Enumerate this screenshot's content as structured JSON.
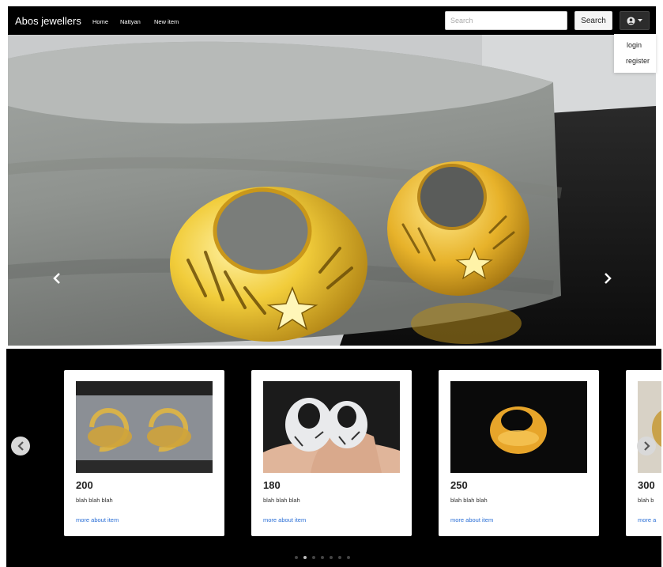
{
  "navbar": {
    "brand": "Abos jewellers",
    "links": [
      "Home",
      "Nattyan",
      "New item"
    ],
    "search_placeholder": "Search",
    "search_button": "Search"
  },
  "user_menu": {
    "icon": "user-circle-icon",
    "items": [
      "login",
      "register"
    ]
  },
  "hero": {
    "image": "gold hoop earrings on grey fur",
    "prev_icon": "chevron-left-icon",
    "next_icon": "chevron-right-icon"
  },
  "products": [
    {
      "price": "200",
      "description": "blah blah blah",
      "link": "more about item",
      "image": "gold-filigree-hoops"
    },
    {
      "price": "180",
      "description": "blah blah blah",
      "link": "more about item",
      "image": "silver-hoops-on-hand"
    },
    {
      "price": "250",
      "description": "blah blah blah",
      "link": "more about item",
      "image": "gold-hoop-on-black"
    },
    {
      "price": "300",
      "description": "blah b",
      "link": "more a",
      "image": "partial-card"
    }
  ],
  "carousel": {
    "pages": 7,
    "active_page": 2,
    "prev_icon": "chevron-left-circle-icon",
    "next_icon": "chevron-right-circle-icon"
  },
  "colors": {
    "navbar": "#000000",
    "link": "#2b6fd6",
    "gold": "#e0b021",
    "strip": "#000000"
  }
}
